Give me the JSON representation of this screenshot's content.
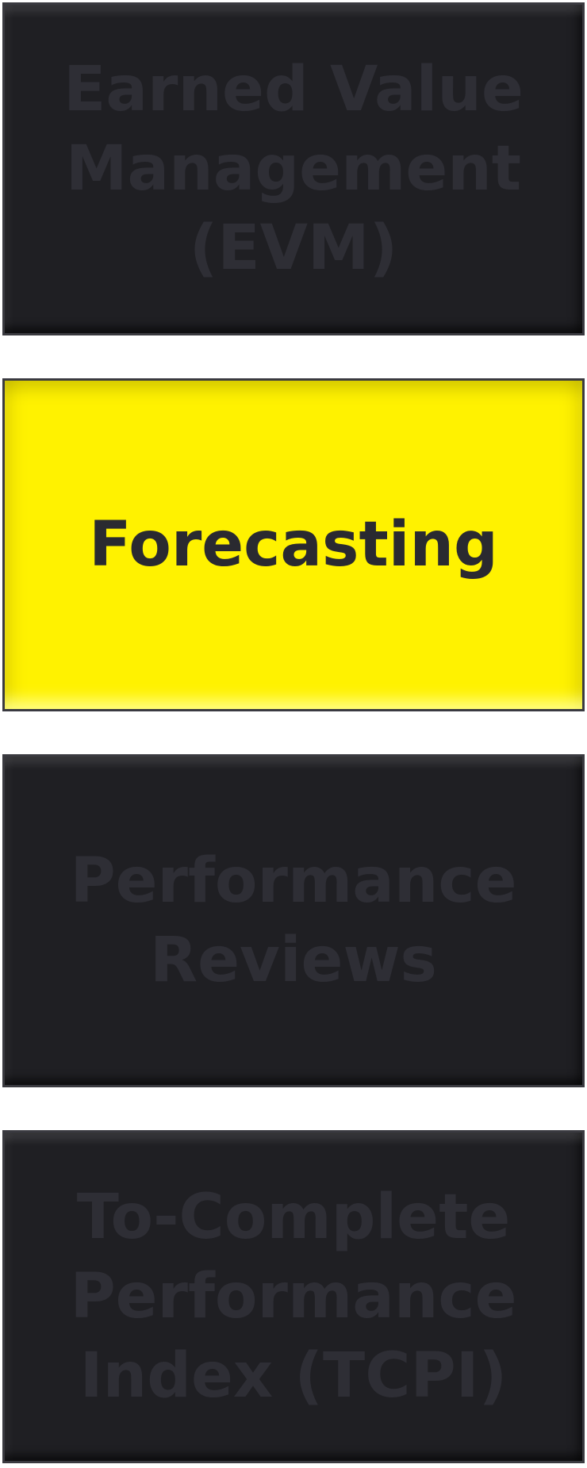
{
  "tiles": [
    {
      "label": "Earned Value\nManagement\n(EVM)",
      "highlighted": false
    },
    {
      "label": "Forecasting",
      "highlighted": true
    },
    {
      "label": "Performance\nReviews",
      "highlighted": false
    },
    {
      "label": "To-Complete\nPerformance\nIndex (TCPI)",
      "highlighted": false
    }
  ],
  "colors": {
    "dark_fill": "#1f1f23",
    "dark_text": "#2e2e35",
    "highlight_fill": "#fff200",
    "highlight_text": "#2a2a30",
    "border": "#3a3a40",
    "background": "#ffffff"
  }
}
